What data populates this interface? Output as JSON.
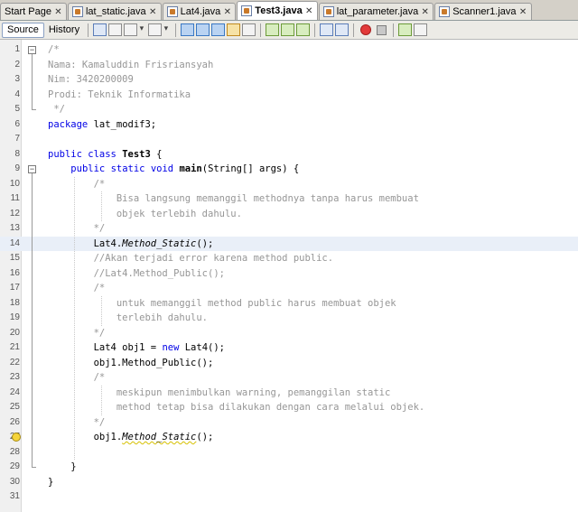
{
  "tabs": [
    {
      "label": "Start Page",
      "icon": "none",
      "active": false
    },
    {
      "label": "lat_static.java",
      "icon": "java-file-icon",
      "active": false
    },
    {
      "label": "Lat4.java",
      "icon": "java-file-icon",
      "active": false
    },
    {
      "label": "Test3.java",
      "icon": "java-file-icon",
      "active": true
    },
    {
      "label": "lat_parameter.java",
      "icon": "java-file-icon",
      "active": false
    },
    {
      "label": "Scanner1.java",
      "icon": "java-file-icon",
      "active": false
    }
  ],
  "toolbar": {
    "source_label": "Source",
    "history_label": "History"
  },
  "editor": {
    "current_line": 14,
    "lines": [
      {
        "n": "1",
        "t": "/*"
      },
      {
        "n": "2",
        "t": "Nama: Kamaluddin Frisriansyah"
      },
      {
        "n": "3",
        "t": "Nim: 3420200009"
      },
      {
        "n": "4",
        "t": "Prodi: Teknik Informatika"
      },
      {
        "n": "5",
        "t": " */"
      },
      {
        "n": "6",
        "t": "package lat_modif3;"
      },
      {
        "n": "7",
        "t": ""
      },
      {
        "n": "8",
        "t": "public class Test3 {"
      },
      {
        "n": "9",
        "t": "    public static void main(String[] args) {"
      },
      {
        "n": "10",
        "t": "        /*"
      },
      {
        "n": "11",
        "t": "            Bisa langsung memanggil methodnya tanpa harus membuat"
      },
      {
        "n": "12",
        "t": "            objek terlebih dahulu."
      },
      {
        "n": "13",
        "t": "        */"
      },
      {
        "n": "14",
        "t": "        Lat4.Method_Static();"
      },
      {
        "n": "15",
        "t": "        //Akan terjadi error karena method public."
      },
      {
        "n": "16",
        "t": "        //Lat4.Method_Public();"
      },
      {
        "n": "17",
        "t": "        /*"
      },
      {
        "n": "18",
        "t": "            untuk memanggil method public harus membuat objek"
      },
      {
        "n": "19",
        "t": "            terlebih dahulu."
      },
      {
        "n": "20",
        "t": "        */"
      },
      {
        "n": "21",
        "t": "        Lat4 obj1 = new Lat4();"
      },
      {
        "n": "22",
        "t": "        obj1.Method_Public();"
      },
      {
        "n": "23",
        "t": "        /*"
      },
      {
        "n": "24",
        "t": "            meskipun menimbulkan warning, pemanggilan static"
      },
      {
        "n": "25",
        "t": "            method tetap bisa dilakukan dengan cara melalui objek."
      },
      {
        "n": "26",
        "t": "        */"
      },
      {
        "n": "27",
        "t": "        obj1.Method_Static();"
      },
      {
        "n": "28",
        "t": ""
      },
      {
        "n": "29",
        "t": "    }"
      },
      {
        "n": "30",
        "t": "}"
      },
      {
        "n": "31",
        "t": ""
      }
    ]
  },
  "colors": {
    "keyword": "#0000e6",
    "comment": "#969696",
    "current_line": "#e9eff8"
  }
}
